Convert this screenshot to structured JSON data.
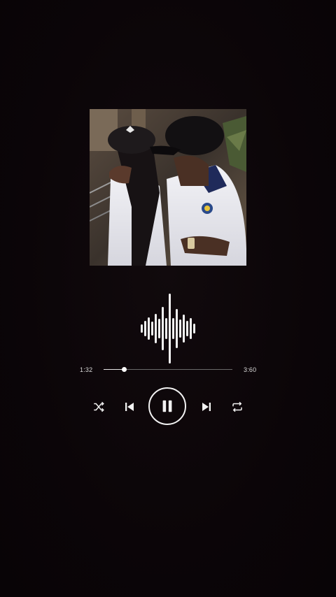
{
  "player": {
    "album_art": {
      "description_icon": "album-art-image"
    },
    "waveform": {
      "bar_levels": [
        0.12,
        0.22,
        0.32,
        0.2,
        0.42,
        0.28,
        0.62,
        0.3,
        1.0,
        0.3,
        0.56,
        0.26,
        0.4,
        0.22,
        0.3,
        0.14
      ]
    },
    "progress": {
      "elapsed": "1:32",
      "total": "3:60",
      "fraction": 0.16
    },
    "controls": {
      "shuffle_icon": "shuffle-icon",
      "previous_icon": "skip-previous-icon",
      "play_pause_icon": "pause-icon",
      "next_icon": "skip-next-icon",
      "repeat_icon": "repeat-icon"
    },
    "colors": {
      "background": "#0c0609",
      "foreground": "#f2f2f2",
      "track": "#6a6a6a"
    }
  }
}
